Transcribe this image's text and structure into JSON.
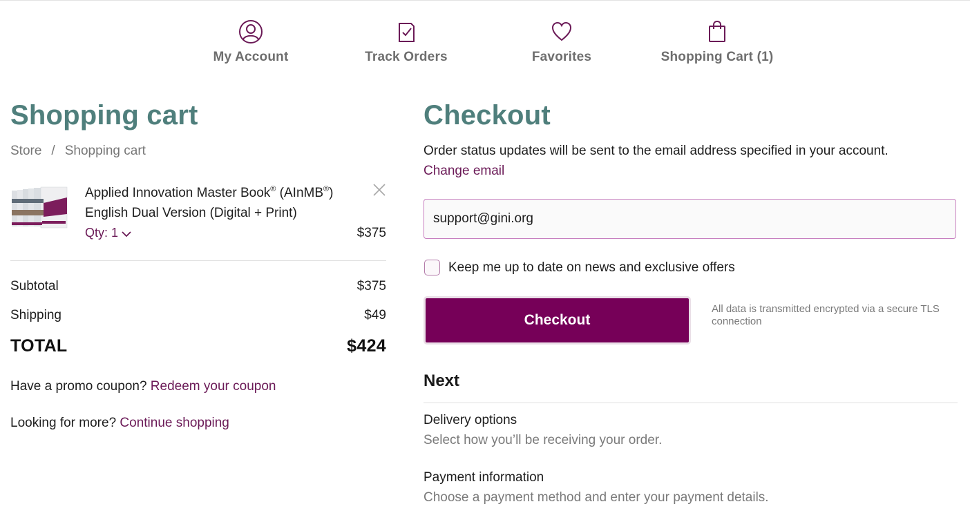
{
  "nav": {
    "items": [
      {
        "label": "My Account",
        "icon": "user-circle-icon"
      },
      {
        "label": "Track Orders",
        "icon": "clipboard-check-icon"
      },
      {
        "label": "Favorites",
        "icon": "heart-icon"
      },
      {
        "label": "Shopping Cart (1)",
        "icon": "shopping-bag-icon"
      }
    ]
  },
  "colors": {
    "accent": "#6b1a57",
    "button": "#760058",
    "heading": "#4f7f7c"
  },
  "cart": {
    "title": "Shopping cart",
    "breadcrumb": {
      "store": "Store",
      "separator": "/",
      "current": "Shopping cart"
    },
    "item": {
      "title_part1": "Applied Innovation Master Book",
      "reg1": "®",
      "title_part2": " (AInMB",
      "reg2": "®",
      "title_part3": ")",
      "title_line2": "English Dual Version (Digital + Print)",
      "qty_label": "Qty: 1",
      "price": "$375"
    },
    "subtotal_label": "Subtotal",
    "subtotal_value": "$375",
    "shipping_label": "Shipping",
    "shipping_value": "$49",
    "total_label": "TOTAL",
    "total_value": "$424",
    "promo_text": "Have a promo coupon? ",
    "promo_link": "Redeem your coupon",
    "more_text": "Looking for more? ",
    "more_link": "Continue shopping"
  },
  "checkout": {
    "title": "Checkout",
    "info": "Order status updates will be sent to the email address specified in your account.",
    "change_email": "Change email",
    "email_value": "support@gini.org",
    "newsletter_label": "Keep me up to date on news and exclusive offers",
    "button_label": "Checkout",
    "secure_note": "All data is transmitted encrypted via a secure TLS connection",
    "next_title": "Next",
    "steps": [
      {
        "title": "Delivery options",
        "subtitle": "Select how you’ll be receiving your order."
      },
      {
        "title": "Payment information",
        "subtitle": "Choose a payment method and enter your payment details."
      }
    ]
  }
}
